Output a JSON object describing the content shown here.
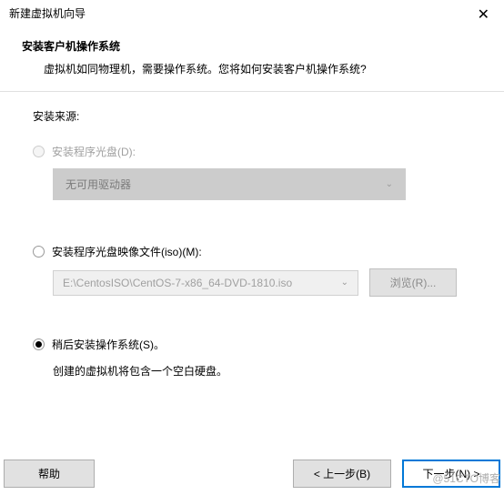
{
  "window": {
    "title": "新建虚拟机向导"
  },
  "header": {
    "title": "安装客户机操作系统",
    "description": "虚拟机如同物理机，需要操作系统。您将如何安装客户机操作系统?"
  },
  "source": {
    "label": "安装来源:"
  },
  "options": {
    "disc": {
      "label": "安装程序光盘(D):",
      "dropdown_text": "无可用驱动器"
    },
    "iso": {
      "label": "安装程序光盘映像文件(iso)(M):",
      "path": "E:\\CentosISO\\CentOS-7-x86_64-DVD-1810.iso",
      "browse_label": "浏览(R)..."
    },
    "later": {
      "label": "稍后安装操作系统(S)。",
      "description": "创建的虚拟机将包含一个空白硬盘。"
    }
  },
  "footer": {
    "help": "帮助",
    "back": "< 上一步(B)",
    "next": "下一步(N) >"
  },
  "watermark": "@51CTO博客"
}
